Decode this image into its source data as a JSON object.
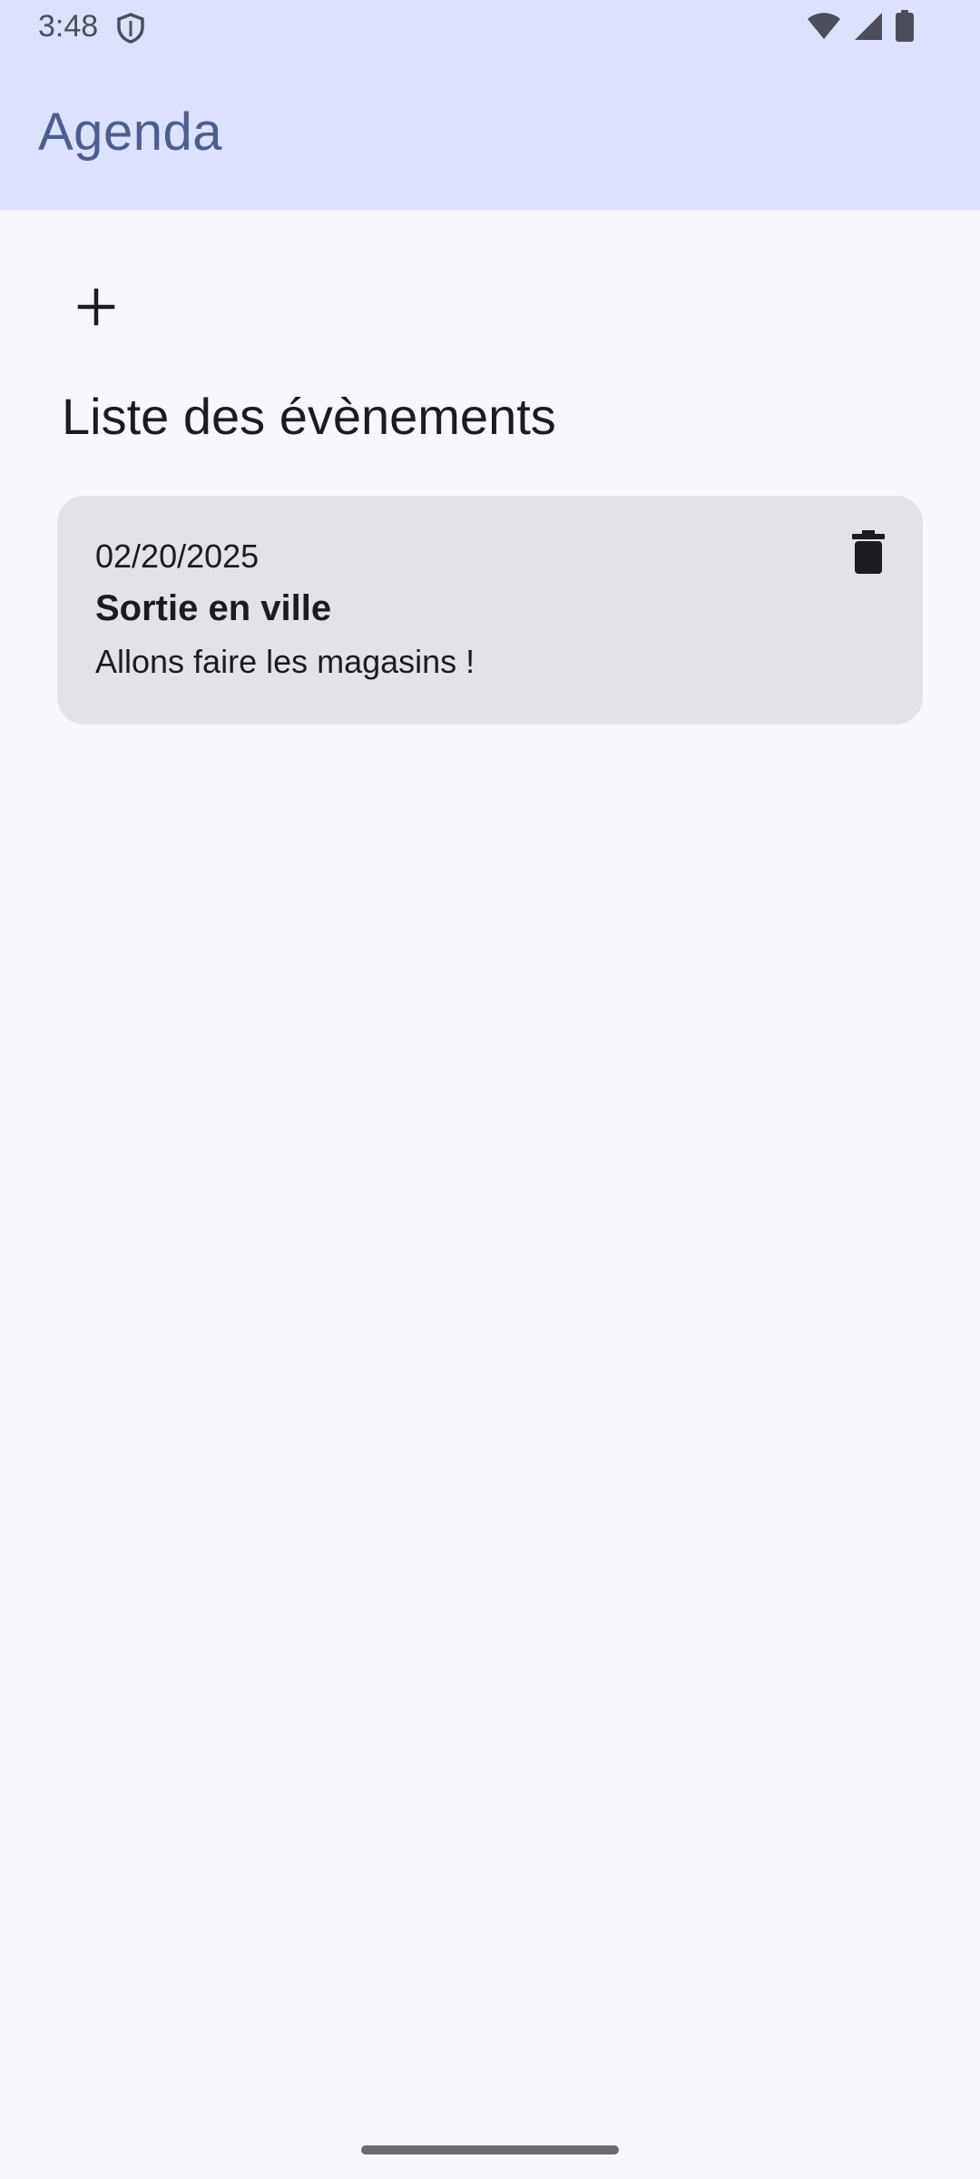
{
  "status_bar": {
    "time": "3:48",
    "icons": [
      "shield-icon",
      "wifi-icon",
      "signal-icon",
      "battery-icon"
    ]
  },
  "app_bar": {
    "title": "Agenda"
  },
  "toolbar": {
    "add_icon": "plus-icon"
  },
  "section": {
    "title": "Liste des évènements"
  },
  "events": [
    {
      "date": "02/20/2025",
      "title": "Sortie en ville",
      "description": "Allons faire les magasins !",
      "delete_icon": "trash-icon"
    }
  ],
  "colors": {
    "app_bar_bg": "#DCE1FE",
    "title_color": "#4A5E92",
    "background": "#F8F7FD",
    "card_bg": "#E3E2E8",
    "text": "#1B1B20"
  }
}
